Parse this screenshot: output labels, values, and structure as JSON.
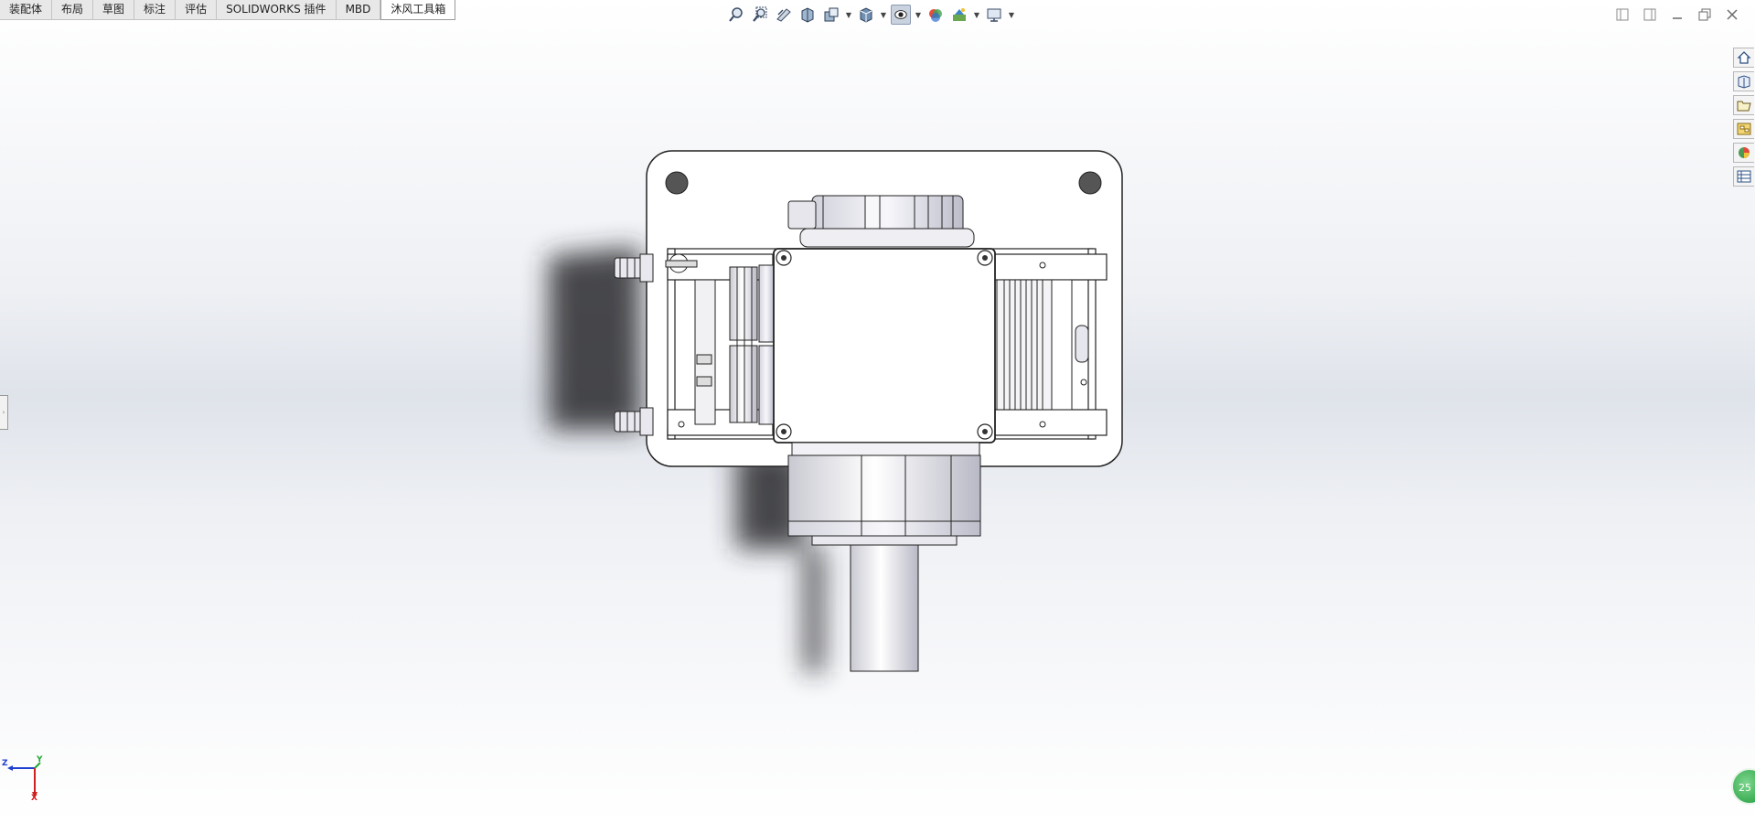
{
  "tabs": [
    {
      "label": "装配体"
    },
    {
      "label": "布局"
    },
    {
      "label": "草图"
    },
    {
      "label": "标注"
    },
    {
      "label": "评估"
    },
    {
      "label": "SOLIDWORKS 插件"
    },
    {
      "label": "MBD"
    },
    {
      "label": "沐风工具箱"
    }
  ],
  "active_tab": "沐风工具箱",
  "hud_toolbar": {
    "icons": [
      "zoom-to-fit-icon",
      "zoom-to-area-icon",
      "previous-view-icon",
      "section-view-icon",
      "dynamic-annotation-icon",
      "view-orientation-icon",
      "display-style-icon",
      "hide-show-items-icon",
      "edit-appearance-icon",
      "apply-scene-icon",
      "view-settings-icon"
    ]
  },
  "task_pane": {
    "icons": [
      "home-icon",
      "design-library-icon",
      "file-explorer-icon",
      "view-palette-icon",
      "appearances-icon",
      "custom-properties-icon"
    ]
  },
  "triad": {
    "x_label": "X",
    "y_label": "Y",
    "z_label": "Z"
  },
  "status_orb": {
    "text": "25"
  },
  "colors": {
    "accent": "#1d9a3a",
    "tab_active_bg": "#ffffff",
    "tab_bg": "#e8e8e8"
  }
}
